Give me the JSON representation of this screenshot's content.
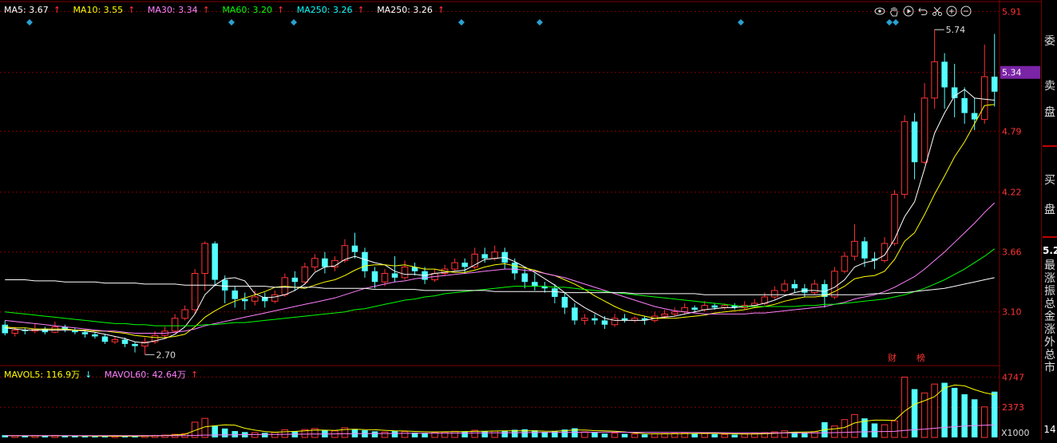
{
  "ma_legend": [
    {
      "label": "MA5: 3.67",
      "arrow": "↑",
      "color": "#ffffff"
    },
    {
      "label": "MA10: 3.55",
      "arrow": "↑",
      "color": "#ffff00"
    },
    {
      "label": "MA30: 3.34",
      "arrow": "↑",
      "color": "#ff80ff"
    },
    {
      "label": "MA60: 3.20",
      "arrow": "↑",
      "color": "#00ff00"
    },
    {
      "label": "MA250: 3.26",
      "arrow": "↑",
      "color": "#00ffff"
    },
    {
      "label": "MA250: 3.26",
      "arrow": "↑",
      "color": "#ffffff"
    }
  ],
  "vol_legend": [
    {
      "label": "MAVOL5: 116.9万",
      "arrow": "↓",
      "color": "#ffff00"
    },
    {
      "label": "MAVOL60: 42.64万",
      "arrow": "↑",
      "color": "#ff80ff"
    }
  ],
  "toolbar_icons": [
    "eye-icon",
    "hand-icon",
    "play-icon",
    "undo-icon",
    "scissors-icon",
    "plus-icon",
    "minus-icon"
  ],
  "price_axis_labels": [
    "5.91",
    "5.34",
    "4.79",
    "4.22",
    "3.66",
    "3.10"
  ],
  "price_axis_current": "5.34",
  "volume_axis_labels": [
    "4747",
    "2373"
  ],
  "volume_axis_unit": "X1000",
  "high_marker": "5.74",
  "low_marker": "2.70",
  "event_tags": [
    "财",
    "榜"
  ],
  "side_panel": {
    "labels_top": [
      "委",
      "卖",
      "盘"
    ],
    "labels_mid": [
      "买",
      "盘"
    ],
    "price": "5.2",
    "vertical_items": [
      "最",
      "涨",
      "振",
      "总",
      "金",
      "涨",
      "外",
      "总",
      "市"
    ],
    "bottom_value": "14"
  },
  "colors": {
    "up": "#ff3333",
    "down": "#54ffff",
    "grid": "#800000",
    "current_price_bg": "#7a24a6"
  },
  "chart_data": {
    "type": "candlestick",
    "price_axis": {
      "min": 2.62,
      "max": 5.98,
      "ticks": [
        5.91,
        5.34,
        4.79,
        4.22,
        3.66,
        3.1
      ]
    },
    "volume_axis": {
      "max": 4900,
      "ticks": [
        4747,
        2373
      ],
      "unit": "X1000"
    },
    "annotations": {
      "high": 5.74,
      "low": 2.7
    },
    "candles": [
      [
        2.98,
        2.9,
        3.02,
        2.88
      ],
      [
        2.9,
        2.93,
        2.96,
        2.87
      ],
      [
        2.93,
        2.92,
        2.95,
        2.89
      ],
      [
        2.92,
        2.94,
        2.99,
        2.9
      ],
      [
        2.94,
        2.91,
        2.96,
        2.89
      ],
      [
        2.91,
        2.96,
        3.01,
        2.9
      ],
      [
        2.96,
        2.93,
        2.98,
        2.91
      ],
      [
        2.93,
        2.91,
        2.95,
        2.89
      ],
      [
        2.91,
        2.89,
        2.93,
        2.86
      ],
      [
        2.89,
        2.87,
        2.91,
        2.85
      ],
      [
        2.87,
        2.82,
        2.89,
        2.8
      ],
      [
        2.82,
        2.84,
        2.87,
        2.8
      ],
      [
        2.84,
        2.8,
        2.86,
        2.77
      ],
      [
        2.8,
        2.78,
        2.82,
        2.72
      ],
      [
        2.78,
        2.82,
        2.86,
        2.7
      ],
      [
        2.82,
        2.88,
        2.92,
        2.8
      ],
      [
        2.88,
        2.92,
        2.96,
        2.85
      ],
      [
        2.92,
        3.04,
        3.08,
        2.9
      ],
      [
        3.04,
        3.12,
        3.16,
        3.02
      ],
      [
        3.12,
        3.46,
        3.5,
        3.08
      ],
      [
        3.46,
        3.74,
        3.76,
        3.3
      ],
      [
        3.74,
        3.4,
        3.76,
        3.34
      ],
      [
        3.4,
        3.3,
        3.44,
        3.18
      ],
      [
        3.3,
        3.22,
        3.34,
        3.14
      ],
      [
        3.22,
        3.2,
        3.28,
        3.12
      ],
      [
        3.2,
        3.24,
        3.3,
        3.16
      ],
      [
        3.24,
        3.2,
        3.28,
        3.14
      ],
      [
        3.2,
        3.26,
        3.3,
        3.18
      ],
      [
        3.26,
        3.42,
        3.46,
        3.24
      ],
      [
        3.42,
        3.38,
        3.48,
        3.3
      ],
      [
        3.38,
        3.52,
        3.56,
        3.36
      ],
      [
        3.52,
        3.6,
        3.64,
        3.48
      ],
      [
        3.6,
        3.52,
        3.66,
        3.46
      ],
      [
        3.52,
        3.58,
        3.62,
        3.48
      ],
      [
        3.58,
        3.72,
        3.78,
        3.56
      ],
      [
        3.72,
        3.66,
        3.84,
        3.6
      ],
      [
        3.66,
        3.48,
        3.7,
        3.42
      ],
      [
        3.48,
        3.38,
        3.52,
        3.32
      ],
      [
        3.38,
        3.46,
        3.5,
        3.34
      ],
      [
        3.46,
        3.42,
        3.62,
        3.38
      ],
      [
        3.42,
        3.52,
        3.58,
        3.4
      ],
      [
        3.52,
        3.48,
        3.56,
        3.44
      ],
      [
        3.48,
        3.4,
        3.52,
        3.36
      ],
      [
        3.4,
        3.46,
        3.5,
        3.38
      ],
      [
        3.46,
        3.5,
        3.54,
        3.44
      ],
      [
        3.5,
        3.56,
        3.6,
        3.48
      ],
      [
        3.56,
        3.52,
        3.6,
        3.46
      ],
      [
        3.52,
        3.64,
        3.7,
        3.5
      ],
      [
        3.64,
        3.6,
        3.7,
        3.56
      ],
      [
        3.6,
        3.66,
        3.72,
        3.58
      ],
      [
        3.66,
        3.56,
        3.7,
        3.5
      ],
      [
        3.56,
        3.46,
        3.6,
        3.4
      ],
      [
        3.46,
        3.38,
        3.5,
        3.32
      ],
      [
        3.38,
        3.34,
        3.46,
        3.3
      ],
      [
        3.34,
        3.32,
        3.38,
        3.28
      ],
      [
        3.32,
        3.24,
        3.36,
        3.18
      ],
      [
        3.24,
        3.14,
        3.28,
        3.08
      ],
      [
        3.14,
        3.02,
        3.18,
        2.98
      ],
      [
        3.02,
        3.04,
        3.08,
        2.98
      ],
      [
        3.04,
        3.02,
        3.08,
        2.98
      ],
      [
        3.02,
        2.98,
        3.06,
        2.94
      ],
      [
        2.98,
        3.04,
        3.08,
        2.96
      ],
      [
        3.04,
        3.02,
        3.08,
        3.0
      ],
      [
        3.02,
        3.04,
        3.06,
        3.0
      ],
      [
        3.04,
        3.02,
        3.06,
        2.98
      ],
      [
        3.02,
        3.06,
        3.1,
        3.0
      ],
      [
        3.06,
        3.08,
        3.12,
        3.04
      ],
      [
        3.08,
        3.1,
        3.14,
        3.06
      ],
      [
        3.1,
        3.14,
        3.18,
        3.08
      ],
      [
        3.14,
        3.12,
        3.16,
        3.1
      ],
      [
        3.12,
        3.16,
        3.2,
        3.1
      ],
      [
        3.16,
        3.14,
        3.18,
        3.12
      ],
      [
        3.14,
        3.16,
        3.18,
        3.12
      ],
      [
        3.16,
        3.14,
        3.18,
        3.12
      ],
      [
        3.14,
        3.16,
        3.2,
        3.12
      ],
      [
        3.16,
        3.18,
        3.22,
        3.14
      ],
      [
        3.18,
        3.24,
        3.28,
        3.16
      ],
      [
        3.24,
        3.3,
        3.34,
        3.22
      ],
      [
        3.3,
        3.36,
        3.4,
        3.28
      ],
      [
        3.36,
        3.32,
        3.4,
        3.28
      ],
      [
        3.32,
        3.28,
        3.36,
        3.24
      ],
      [
        3.28,
        3.36,
        3.4,
        3.26
      ],
      [
        3.36,
        3.24,
        3.4,
        3.14
      ],
      [
        3.24,
        3.48,
        3.52,
        3.22
      ],
      [
        3.48,
        3.62,
        3.66,
        3.46
      ],
      [
        3.62,
        3.76,
        3.92,
        3.58
      ],
      [
        3.76,
        3.6,
        3.8,
        3.52
      ],
      [
        3.6,
        3.58,
        3.66,
        3.5
      ],
      [
        3.58,
        3.74,
        3.8,
        3.56
      ],
      [
        3.74,
        4.2,
        4.24,
        3.72
      ],
      [
        4.2,
        4.88,
        4.94,
        4.16
      ],
      [
        4.88,
        4.5,
        4.96,
        4.34
      ],
      [
        4.5,
        5.1,
        5.24,
        4.48
      ],
      [
        5.1,
        5.44,
        5.74,
        5.0
      ],
      [
        5.44,
        5.2,
        5.52,
        5.0
      ],
      [
        5.2,
        5.1,
        5.42,
        4.92
      ],
      [
        5.1,
        4.96,
        5.2,
        4.86
      ],
      [
        4.96,
        4.9,
        5.1,
        4.8
      ],
      [
        4.9,
        5.3,
        5.6,
        4.86
      ],
      [
        5.3,
        5.16,
        5.7,
        5.02
      ]
    ],
    "volumes": [
      180,
      130,
      110,
      150,
      120,
      160,
      110,
      100,
      90,
      80,
      110,
      90,
      100,
      120,
      140,
      160,
      180,
      240,
      300,
      1200,
      1500,
      900,
      700,
      500,
      420,
      380,
      360,
      400,
      600,
      500,
      620,
      700,
      560,
      520,
      760,
      640,
      560,
      480,
      420,
      520,
      460,
      380,
      360,
      400,
      420,
      480,
      440,
      560,
      480,
      500,
      520,
      600,
      640,
      560,
      440,
      480,
      620,
      720,
      440,
      380,
      300,
      340,
      280,
      260,
      240,
      280,
      300,
      320,
      360,
      280,
      300,
      260,
      240,
      220,
      280,
      320,
      380,
      440,
      520,
      420,
      380,
      460,
      1200,
      900,
      1400,
      1800,
      1500,
      1100,
      1000,
      1300,
      4747,
      3800,
      3500,
      4200,
      4300,
      3900,
      3400,
      3000,
      2400,
      3600
    ],
    "ma5": [
      2.95,
      2.94,
      2.93,
      2.93,
      2.93,
      2.93,
      2.93,
      2.93,
      2.92,
      2.91,
      2.89,
      2.87,
      2.85,
      2.82,
      2.81,
      2.83,
      2.85,
      2.89,
      2.96,
      3.08,
      3.26,
      3.35,
      3.41,
      3.42,
      3.39,
      3.27,
      3.23,
      3.24,
      3.26,
      3.3,
      3.36,
      3.47,
      3.52,
      3.53,
      3.59,
      3.62,
      3.59,
      3.56,
      3.54,
      3.48,
      3.45,
      3.45,
      3.44,
      3.46,
      3.47,
      3.48,
      3.49,
      3.54,
      3.59,
      3.6,
      3.61,
      3.57,
      3.52,
      3.47,
      3.41,
      3.35,
      3.28,
      3.2,
      3.14,
      3.09,
      3.04,
      3.02,
      3.02,
      3.02,
      3.02,
      3.04,
      3.05,
      3.06,
      3.08,
      3.1,
      3.12,
      3.13,
      3.14,
      3.14,
      3.15,
      3.16,
      3.18,
      3.21,
      3.25,
      3.28,
      3.3,
      3.3,
      3.29,
      3.33,
      3.4,
      3.52,
      3.56,
      3.58,
      3.63,
      3.78,
      3.99,
      4.13,
      4.44,
      4.77,
      4.96,
      5.12,
      5.18,
      5.1,
      5.09,
      5.08
    ],
    "ma10": [
      2.96,
      2.95,
      2.95,
      2.94,
      2.94,
      2.94,
      2.94,
      2.93,
      2.93,
      2.92,
      2.92,
      2.91,
      2.9,
      2.88,
      2.87,
      2.86,
      2.86,
      2.87,
      2.89,
      2.96,
      3.05,
      3.11,
      3.16,
      3.2,
      3.23,
      3.26,
      3.29,
      3.33,
      3.34,
      3.33,
      3.32,
      3.35,
      3.38,
      3.4,
      3.44,
      3.49,
      3.53,
      3.54,
      3.54,
      3.53,
      3.54,
      3.52,
      3.5,
      3.5,
      3.48,
      3.47,
      3.47,
      3.49,
      3.52,
      3.54,
      3.55,
      3.53,
      3.51,
      3.49,
      3.46,
      3.44,
      3.4,
      3.36,
      3.31,
      3.25,
      3.2,
      3.15,
      3.11,
      3.08,
      3.06,
      3.04,
      3.04,
      3.04,
      3.05,
      3.06,
      3.07,
      3.09,
      3.1,
      3.11,
      3.12,
      3.14,
      3.15,
      3.17,
      3.2,
      3.22,
      3.24,
      3.24,
      3.25,
      3.29,
      3.34,
      3.41,
      3.43,
      3.44,
      3.48,
      3.59,
      3.76,
      3.84,
      4.01,
      4.2,
      4.37,
      4.55,
      4.69,
      4.86,
      5.03,
      5.04
    ],
    "ma30": [
      3.02,
      3.01,
      3.0,
      2.99,
      2.98,
      2.97,
      2.96,
      2.95,
      2.94,
      2.93,
      2.92,
      2.92,
      2.91,
      2.9,
      2.9,
      2.9,
      2.9,
      2.91,
      2.92,
      2.94,
      2.97,
      2.99,
      3.01,
      3.03,
      3.05,
      3.07,
      3.09,
      3.11,
      3.13,
      3.15,
      3.17,
      3.19,
      3.21,
      3.23,
      3.26,
      3.29,
      3.32,
      3.34,
      3.36,
      3.38,
      3.39,
      3.41,
      3.42,
      3.43,
      3.44,
      3.45,
      3.46,
      3.47,
      3.48,
      3.49,
      3.5,
      3.5,
      3.49,
      3.48,
      3.46,
      3.44,
      3.42,
      3.39,
      3.36,
      3.33,
      3.3,
      3.27,
      3.24,
      3.21,
      3.18,
      3.15,
      3.13,
      3.11,
      3.1,
      3.09,
      3.08,
      3.08,
      3.08,
      3.08,
      3.08,
      3.09,
      3.09,
      3.1,
      3.11,
      3.12,
      3.13,
      3.14,
      3.15,
      3.17,
      3.19,
      3.22,
      3.24,
      3.26,
      3.29,
      3.33,
      3.38,
      3.43,
      3.5,
      3.58,
      3.66,
      3.75,
      3.84,
      3.93,
      4.03,
      4.12
    ],
    "ma60": [
      3.1,
      3.09,
      3.08,
      3.07,
      3.06,
      3.05,
      3.04,
      3.03,
      3.02,
      3.01,
      3.0,
      2.99,
      2.99,
      2.98,
      2.98,
      2.97,
      2.97,
      2.97,
      2.97,
      2.97,
      2.98,
      2.98,
      2.99,
      3.0,
      3.0,
      3.01,
      3.02,
      3.03,
      3.04,
      3.05,
      3.06,
      3.07,
      3.08,
      3.09,
      3.1,
      3.12,
      3.13,
      3.15,
      3.17,
      3.19,
      3.21,
      3.22,
      3.24,
      3.25,
      3.27,
      3.28,
      3.29,
      3.3,
      3.31,
      3.32,
      3.33,
      3.34,
      3.34,
      3.34,
      3.34,
      3.33,
      3.33,
      3.32,
      3.31,
      3.3,
      3.29,
      3.28,
      3.27,
      3.26,
      3.25,
      3.24,
      3.23,
      3.22,
      3.21,
      3.2,
      3.19,
      3.18,
      3.17,
      3.16,
      3.15,
      3.15,
      3.15,
      3.15,
      3.15,
      3.15,
      3.16,
      3.16,
      3.17,
      3.17,
      3.18,
      3.19,
      3.2,
      3.21,
      3.22,
      3.24,
      3.26,
      3.29,
      3.32,
      3.36,
      3.4,
      3.45,
      3.5,
      3.56,
      3.62,
      3.69
    ],
    "ma250": [
      3.4,
      3.4,
      3.4,
      3.39,
      3.39,
      3.39,
      3.38,
      3.38,
      3.38,
      3.38,
      3.37,
      3.37,
      3.37,
      3.37,
      3.36,
      3.36,
      3.36,
      3.36,
      3.35,
      3.35,
      3.35,
      3.35,
      3.34,
      3.34,
      3.34,
      3.34,
      3.34,
      3.33,
      3.33,
      3.33,
      3.33,
      3.33,
      3.32,
      3.32,
      3.32,
      3.32,
      3.32,
      3.31,
      3.31,
      3.31,
      3.31,
      3.31,
      3.3,
      3.3,
      3.3,
      3.3,
      3.3,
      3.3,
      3.3,
      3.29,
      3.29,
      3.29,
      3.29,
      3.29,
      3.29,
      3.29,
      3.28,
      3.28,
      3.28,
      3.28,
      3.28,
      3.28,
      3.28,
      3.27,
      3.27,
      3.27,
      3.27,
      3.27,
      3.27,
      3.27,
      3.26,
      3.26,
      3.26,
      3.26,
      3.26,
      3.26,
      3.26,
      3.26,
      3.26,
      3.26,
      3.26,
      3.26,
      3.26,
      3.26,
      3.26,
      3.26,
      3.26,
      3.27,
      3.27,
      3.28,
      3.28,
      3.29,
      3.3,
      3.31,
      3.32,
      3.34,
      3.36,
      3.38,
      3.4,
      3.42
    ],
    "mavol5": [
      140,
      135,
      130,
      128,
      132,
      134,
      130,
      128,
      118,
      110,
      98,
      96,
      94,
      100,
      112,
      124,
      150,
      188,
      246,
      548,
      832,
      920,
      992,
      968,
      720,
      574,
      464,
      410,
      448,
      470,
      520,
      580,
      574,
      552,
      622,
      650,
      612,
      600,
      560,
      522,
      500,
      472,
      444,
      432,
      448,
      452,
      464,
      480,
      490,
      500,
      524,
      514,
      530,
      520,
      498,
      488,
      536,
      580,
      582,
      532,
      520,
      484,
      432,
      352,
      304,
      286,
      284,
      286,
      304,
      308,
      320,
      312,
      300,
      284,
      268,
      268,
      286,
      318,
      368,
      412,
      428,
      444,
      604,
      676,
      780,
      1140,
      1280,
      1360,
      1360,
      1340,
      2068,
      2606,
      2890,
      3206,
      3900,
      4120,
      4060,
      3766,
      3520,
      3360
    ],
    "mavol60": [
      140,
      140,
      140,
      140,
      140,
      140,
      140,
      140,
      140,
      140,
      140,
      140,
      140,
      140,
      140,
      140,
      140,
      140,
      140,
      160,
      180,
      190,
      200,
      210,
      218,
      226,
      232,
      238,
      246,
      252,
      258,
      266,
      272,
      278,
      286,
      294,
      300,
      306,
      310,
      316,
      320,
      324,
      328,
      332,
      336,
      340,
      344,
      350,
      356,
      360,
      366,
      372,
      378,
      384,
      388,
      392,
      398,
      404,
      408,
      410,
      412,
      412,
      410,
      408,
      404,
      400,
      396,
      392,
      388,
      384,
      380,
      376,
      372,
      366,
      362,
      358,
      356,
      354,
      354,
      352,
      350,
      350,
      366,
      378,
      396,
      420,
      440,
      454,
      466,
      480,
      548,
      604,
      656,
      720,
      784,
      842,
      890,
      928,
      956,
      994
    ]
  }
}
